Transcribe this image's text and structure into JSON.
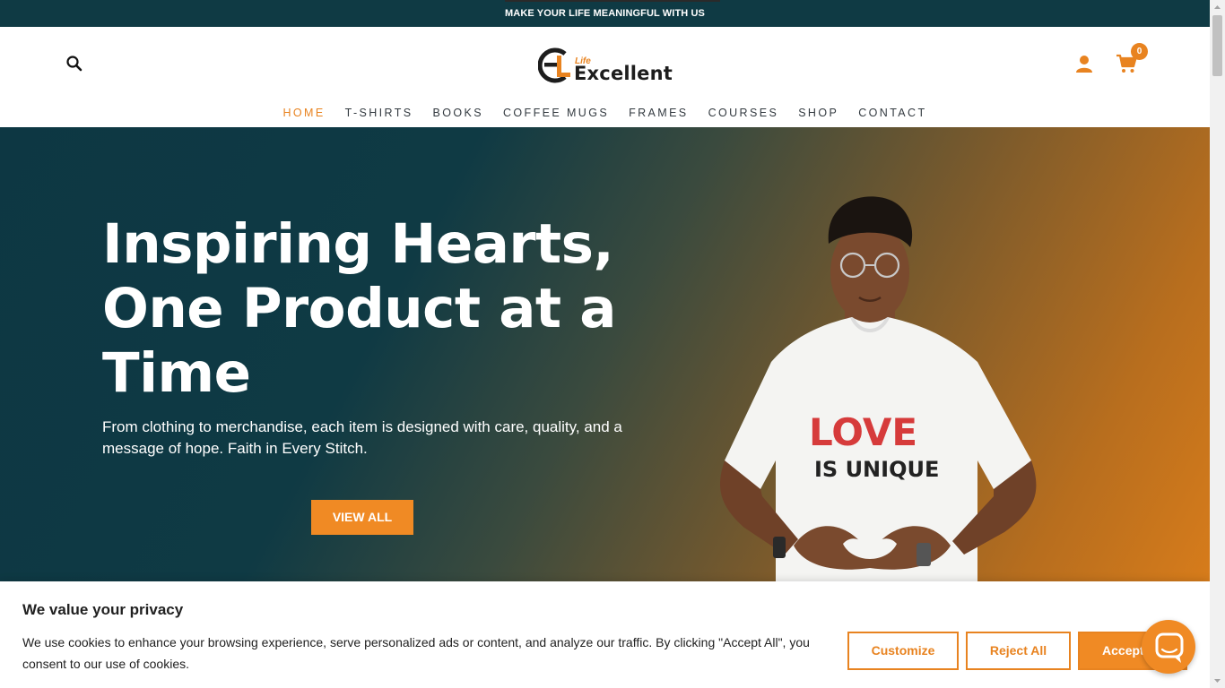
{
  "topbar": {
    "message": "MAKE YOUR LIFE MEANINGFUL WITH US"
  },
  "header": {
    "logo": {
      "small": "Life",
      "word": "Excellent"
    },
    "cart_count": "0"
  },
  "nav": {
    "items": [
      {
        "label": "HOME",
        "active": true
      },
      {
        "label": "T-SHIRTS"
      },
      {
        "label": "BOOKS"
      },
      {
        "label": "COFFEE MUGS"
      },
      {
        "label": "FRAMES"
      },
      {
        "label": "COURSES"
      },
      {
        "label": "SHOP"
      },
      {
        "label": "CONTACT"
      }
    ]
  },
  "hero": {
    "title_lines": [
      "Inspiring Hearts,",
      "One Product at a",
      "Time"
    ],
    "subtitle_lines": [
      "From clothing to merchandise, each item is designed with care, quality, and a",
      "message of hope. Faith in Every Stitch."
    ],
    "button": "VIEW ALL",
    "shirt_print": {
      "line1": "LOVE",
      "line2": "IS UNIQUE"
    }
  },
  "cookie": {
    "title": "We value your privacy",
    "text_lines": [
      "We use cookies to enhance your browsing experience, serve personalized ads or content, and analyze our traffic. By clicking \"Accept All\", you",
      "consent to our use of cookies."
    ],
    "customize": "Customize",
    "reject": "Reject All",
    "accept": "Accept All"
  },
  "colors": {
    "accent": "#e88320",
    "dark_teal": "#0f3a44",
    "text": "#212121"
  },
  "icons": [
    "search-icon",
    "user-icon",
    "cart-icon",
    "chat-icon"
  ]
}
